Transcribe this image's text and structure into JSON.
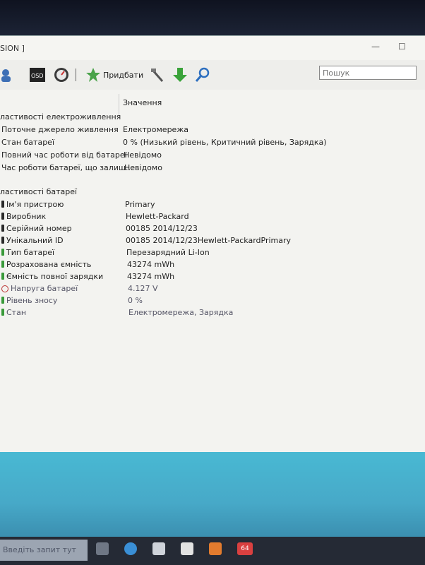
{
  "window": {
    "title": "SION ]",
    "minimize": "—",
    "maximize": "☐"
  },
  "toolbar": {
    "osd_label": "OSD",
    "add_label": "Придбати",
    "search_placeholder": "Пошук"
  },
  "table": {
    "value_header": "Значення",
    "power_group": {
      "title": "ластивості електроживлення",
      "rows": [
        {
          "label": "Поточне джерело живлення",
          "value": "Електромережа"
        },
        {
          "label": "Стан батареї",
          "value": "0 % (Низький рівень, Критичний рівень, Зарядка)"
        },
        {
          "label": "Повний час роботи від батареї",
          "value": "Невідомо"
        },
        {
          "label": "Час роботи батареї, що залиш...",
          "value": "Невідомо"
        }
      ]
    },
    "battery_group": {
      "title": "ластивості батареї",
      "rows": [
        {
          "label": "Ім'я пристрою",
          "value": "Primary"
        },
        {
          "label": "Виробник",
          "value": "Hewlett-Packard"
        },
        {
          "label": "Серійний номер",
          "value": "00185 2014/12/23"
        },
        {
          "label": "Унікальний ID",
          "value": "00185 2014/12/23Hewlett-PackardPrimary"
        },
        {
          "label": "Тип батареї",
          "value": "Перезарядний Li-Ion"
        },
        {
          "label": "Розрахована ємність",
          "value": "43274 mWh"
        },
        {
          "label": "Ємність повної зарядки",
          "value": "43274 mWh"
        },
        {
          "label": "Напруга батареї",
          "value": "4.127 V"
        },
        {
          "label": "Рівень зносу",
          "value": "0 %"
        },
        {
          "label": "Стан",
          "value": "Електромережа, Зарядка"
        }
      ]
    }
  },
  "taskbar": {
    "search_text": "Введіть запит тут",
    "badge": "64"
  },
  "colors": {
    "window_bg": "#f2f2ef",
    "desktop": "#47a9c8",
    "taskbar": "#252a35",
    "accent_green": "#3aa33a"
  }
}
